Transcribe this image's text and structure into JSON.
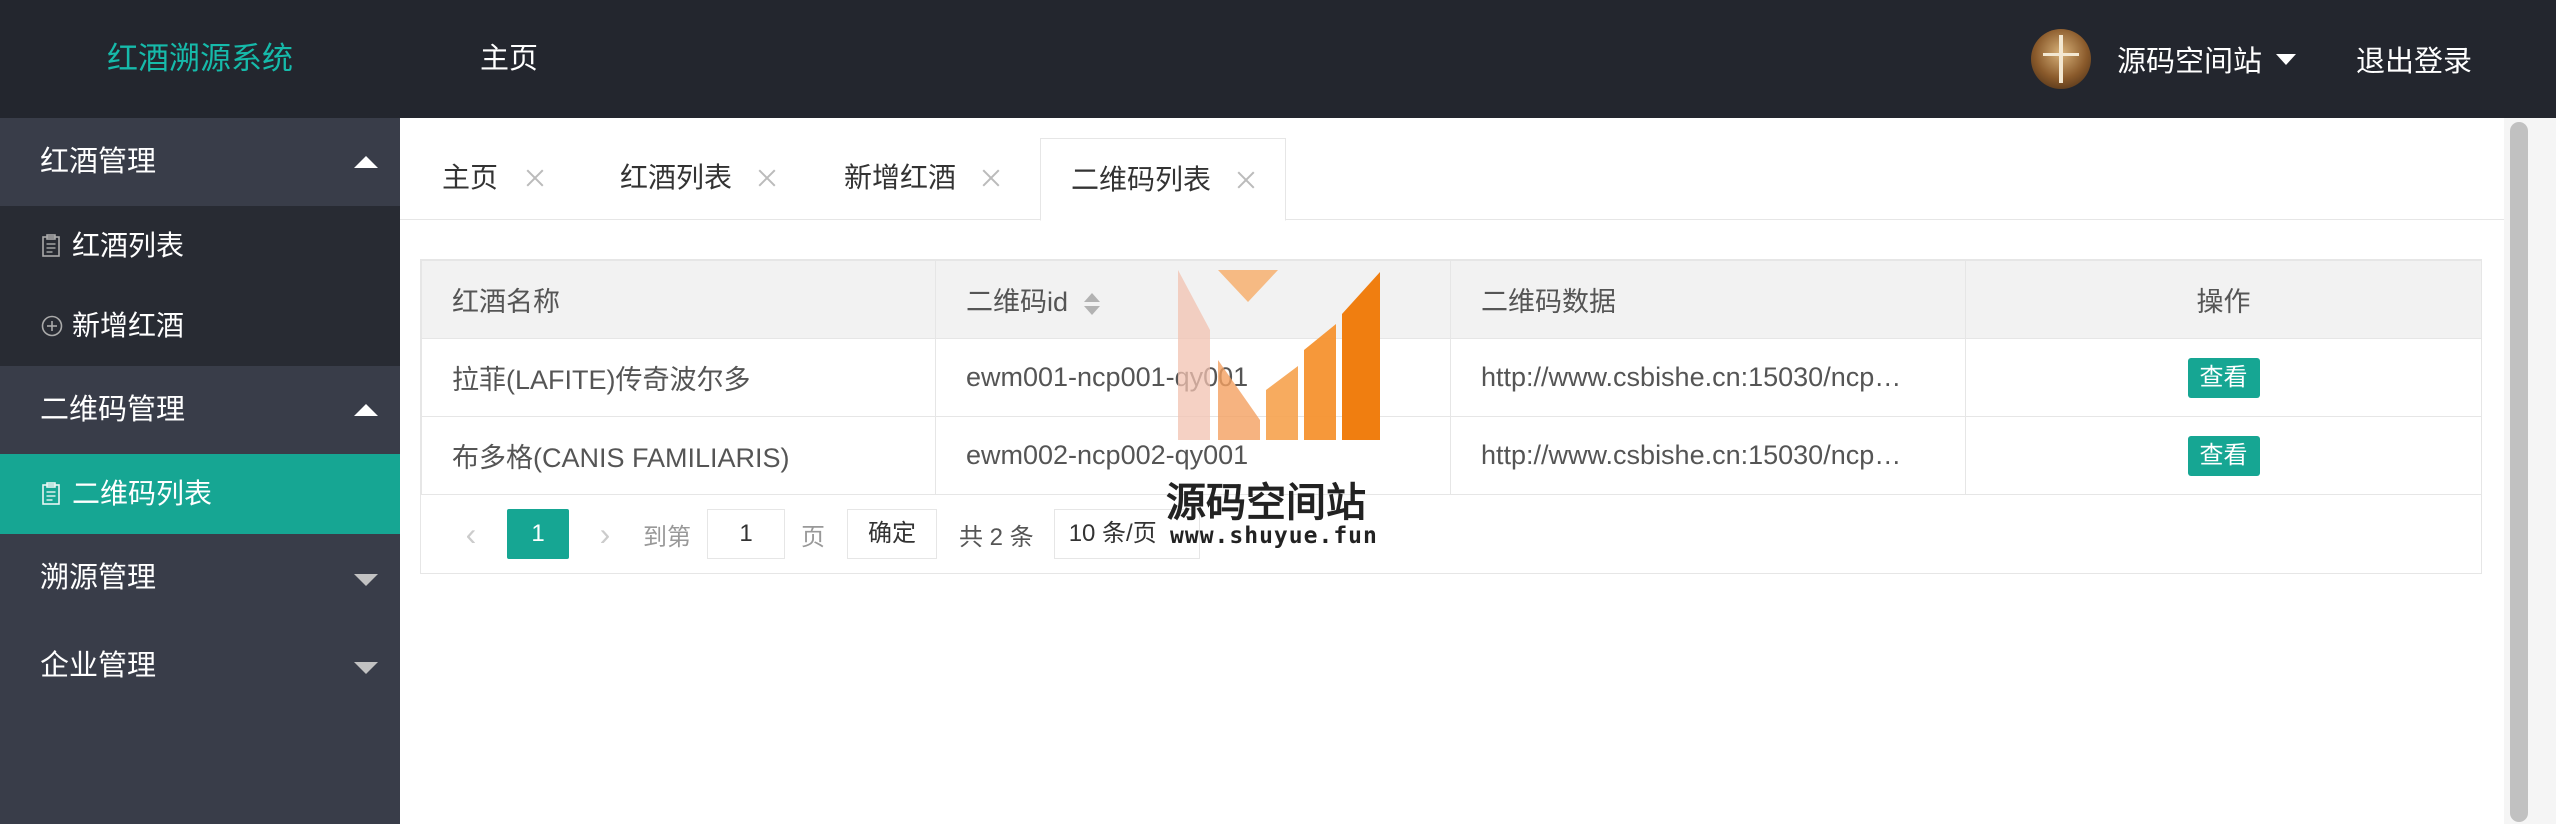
{
  "header": {
    "logo": "红酒溯源系统",
    "nav_home": "主页",
    "user_name": "源码空间站",
    "logout": "退出登录"
  },
  "sidebar": {
    "groups": [
      {
        "label": "红酒管理",
        "items": [
          {
            "label": "红酒列表",
            "icon": "clipboard-icon"
          },
          {
            "label": "新增红酒",
            "icon": "plus-circle-icon"
          }
        ]
      },
      {
        "label": "二维码管理",
        "items": [
          {
            "label": "二维码列表",
            "icon": "clipboard-icon"
          }
        ]
      },
      {
        "label": "溯源管理"
      },
      {
        "label": "企业管理"
      }
    ]
  },
  "tabs": [
    {
      "label": "主页"
    },
    {
      "label": "红酒列表"
    },
    {
      "label": "新增红酒"
    },
    {
      "label": "二维码列表"
    }
  ],
  "table": {
    "headers": [
      "红酒名称",
      "二维码id",
      "二维码数据",
      "操作"
    ],
    "rows": [
      {
        "name": "拉菲(LAFITE)传奇波尔多",
        "qr_id": "ewm001-ncp001-qy001",
        "qr_data": "http://www.csbishe.cn:15030/ncp…",
        "action": "查看"
      },
      {
        "name": "布多格(CANIS FAMILIARIS)",
        "qr_id": "ewm002-ncp002-qy001",
        "qr_data": "http://www.csbishe.cn:15030/ncp…",
        "action": "查看"
      }
    ]
  },
  "pager": {
    "current": "1",
    "goto_prefix": "到第",
    "goto_value": "1",
    "goto_suffix": "页",
    "confirm": "确定",
    "total": "共 2 条",
    "page_size": "10 条/页"
  },
  "watermark": {
    "text": "源码空间站",
    "url": "www.shuyue.fun"
  },
  "colors": {
    "header_bg": "#23262e",
    "sidebar_bg": "#393d49",
    "accent": "#16a693",
    "logo": "#16baaa"
  }
}
